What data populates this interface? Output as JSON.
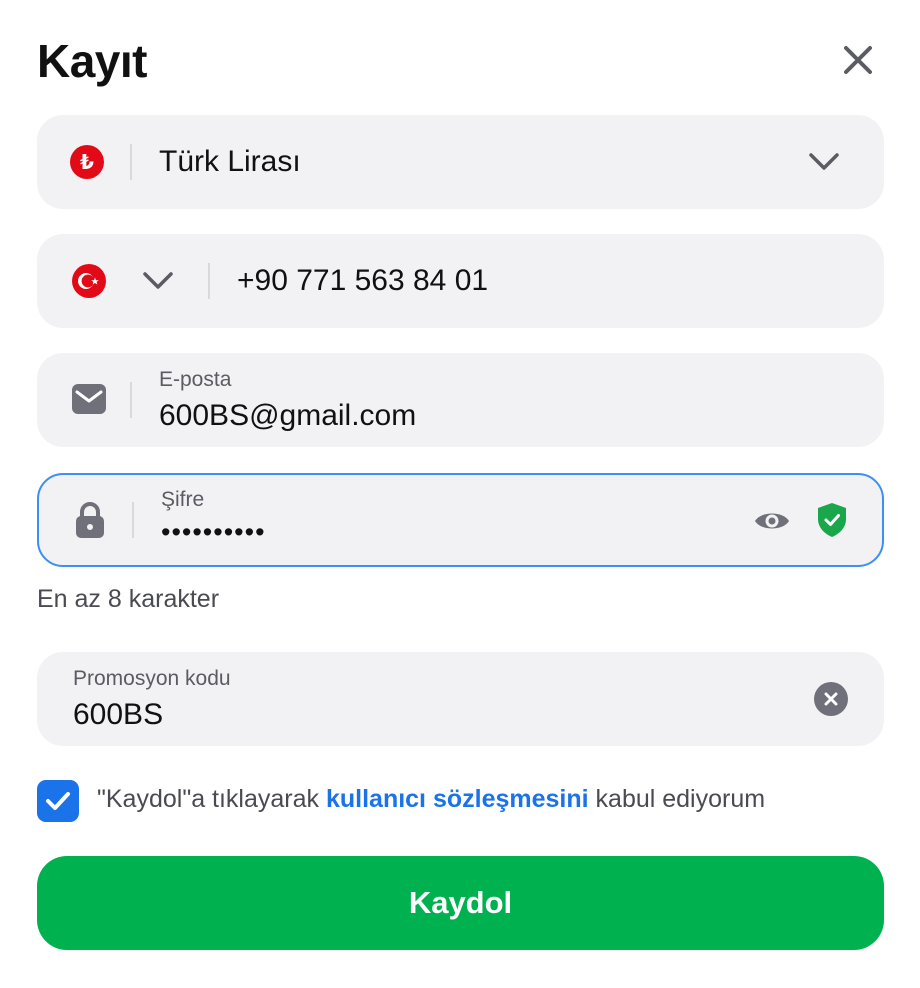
{
  "modal": {
    "title": "Kayıt"
  },
  "currency": {
    "value": "Türk Lirası",
    "icon": "turkish-lira-icon",
    "symbol": "₺"
  },
  "phone": {
    "value": "+90 771 563 84 01",
    "flag": "turkey-flag-icon"
  },
  "email": {
    "label": "E-posta",
    "value": "600BS@gmail.com"
  },
  "password": {
    "label": "Şifre",
    "masked_value": "••••••••••"
  },
  "password_hint": "En az 8 karakter",
  "promo": {
    "label": "Promosyon kodu",
    "value": "600BS"
  },
  "terms": {
    "checked": true,
    "prefix": "\"Kaydol\"a tıklayarak ",
    "link": "kullanıcı sözleşmesini",
    "suffix": " kabul ediyorum"
  },
  "submit": {
    "label": "Kaydol"
  },
  "colors": {
    "accent": "#1a73e8",
    "submit": "#00b14f",
    "field_bg": "#f2f2f4",
    "focus_border": "#3d8ef5",
    "shield": "#1aa64a",
    "flag_red": "#e30a17"
  }
}
